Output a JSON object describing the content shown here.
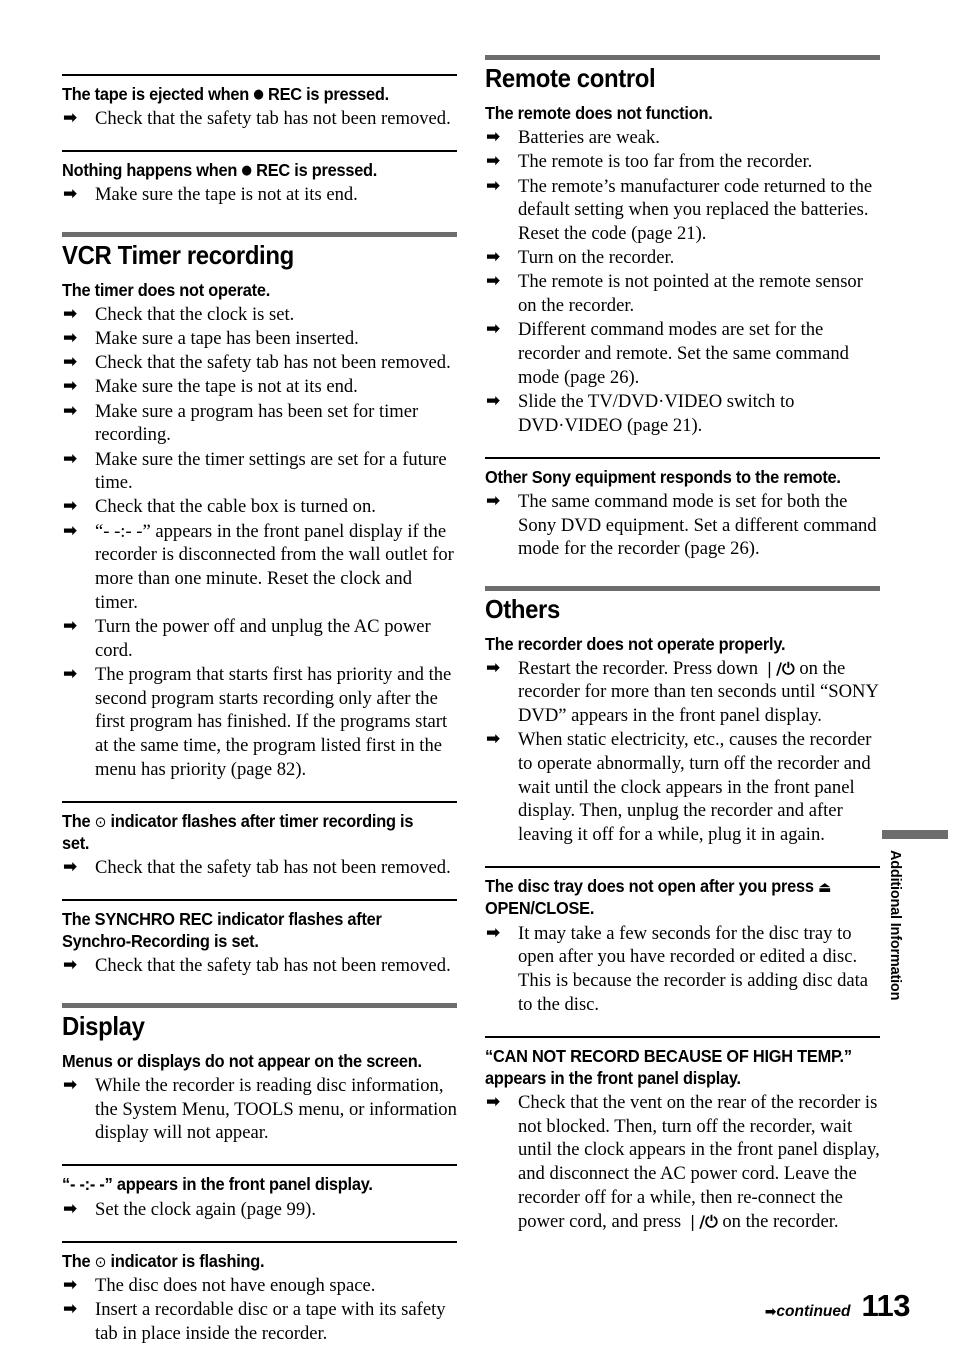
{
  "page": {
    "number": "113",
    "continued_label": "continued",
    "continued_arrow": "➡",
    "side_tab_label": "Additional Information",
    "accent_gray": "#6d6d6d"
  },
  "symbols": {
    "arrow": "➡",
    "rec_dot": "●",
    "clock": "⊙",
    "power": "⏻",
    "eject": "⏏"
  },
  "left_column": [
    {
      "type": "block",
      "rule": "thin",
      "heading_parts": [
        {
          "t": "text",
          "v": "The tape is ejected when "
        },
        {
          "t": "dot",
          "v": "●"
        },
        {
          "t": "text",
          "v": " REC is pressed."
        }
      ],
      "heading_plain": "The tape is ejected when ● REC is pressed.",
      "items": [
        "Check that the safety tab has not been removed."
      ]
    },
    {
      "type": "block",
      "rule": "thin",
      "heading_parts": [
        {
          "t": "text",
          "v": "Nothing happens when "
        },
        {
          "t": "dot",
          "v": "●"
        },
        {
          "t": "text",
          "v": " REC is pressed."
        }
      ],
      "heading_plain": "Nothing happens when ● REC is pressed.",
      "items": [
        "Make sure the tape is not at its end."
      ]
    },
    {
      "type": "section",
      "title": "VCR Timer recording"
    },
    {
      "type": "block",
      "rule": "none",
      "heading_plain": "The timer does not operate.",
      "items": [
        "Check that the clock is set.",
        "Make sure a tape has been inserted.",
        "Check that the safety tab has not been removed.",
        "Make sure the tape is not at its end.",
        "Make sure a program has been set for timer recording.",
        "Make sure the timer settings are set for a future time.",
        "Check that the cable box is turned on.",
        "“- -:- -” appears in the front panel display if the recorder is disconnected from the wall outlet for more than one minute. Reset the clock and timer.",
        "Turn the power off and unplug the AC power cord.",
        "The program that starts first has priority and the second program starts recording only after the first program has finished. If the programs start at the same time, the program listed first in the menu has priority (page 82)."
      ]
    },
    {
      "type": "block",
      "rule": "thin",
      "heading_parts": [
        {
          "t": "text",
          "v": "The "
        },
        {
          "t": "sym",
          "v": "⊙"
        },
        {
          "t": "text",
          "v": " indicator flashes after timer recording is set."
        }
      ],
      "heading_plain": "The ⊙ indicator flashes after timer recording is set.",
      "items": [
        "Check that the safety tab has not been removed."
      ]
    },
    {
      "type": "block",
      "rule": "thin",
      "heading_plain": "The SYNCHRO REC indicator flashes after Synchro-Recording is set.",
      "items": [
        "Check that the safety tab has not been removed."
      ]
    },
    {
      "type": "section",
      "title": "Display"
    },
    {
      "type": "block",
      "rule": "none",
      "heading_plain": "Menus or displays do not appear on the screen.",
      "items": [
        "While the recorder is reading disc information, the System Menu, TOOLS menu, or information display will not appear."
      ]
    },
    {
      "type": "block",
      "rule": "thin",
      "heading_plain": "“- -:- -” appears in the front panel display.",
      "items": [
        "Set the clock again (page 99)."
      ]
    },
    {
      "type": "block",
      "rule": "thin",
      "heading_parts": [
        {
          "t": "text",
          "v": "The "
        },
        {
          "t": "sym",
          "v": "⊙"
        },
        {
          "t": "text",
          "v": " indicator is flashing."
        }
      ],
      "heading_plain": "The ⊙ indicator is flashing.",
      "items": [
        "The disc does not have enough space.",
        "Insert a recordable disc or a tape with its safety tab in place inside the recorder."
      ]
    }
  ],
  "right_column": [
    {
      "type": "section",
      "title": "Remote control"
    },
    {
      "type": "block",
      "rule": "none",
      "heading_plain": "The remote does not function.",
      "items": [
        "Batteries are weak.",
        "The remote is too far from the recorder.",
        "The remote’s manufacturer code returned to the default setting when you replaced the batteries. Reset the code (page 21).",
        "Turn on the recorder.",
        "The remote is not pointed at the remote sensor on the recorder.",
        "Different command modes are set for the recorder and remote. Set the same command mode (page 26).",
        "Slide the TV/DVD·VIDEO switch to DVD·VIDEO (page 21)."
      ]
    },
    {
      "type": "block",
      "rule": "thin",
      "heading_plain": "Other Sony equipment responds to the remote.",
      "items": [
        "The same command mode is set for both the Sony DVD equipment. Set a different command mode for the recorder (page 26)."
      ]
    },
    {
      "type": "section",
      "title": "Others"
    },
    {
      "type": "block",
      "rule": "none",
      "heading_plain": "The recorder does not operate properly.",
      "items_rich": [
        [
          {
            "t": "text",
            "v": "Restart the recorder. Press down "
          },
          {
            "t": "pw",
            "v": "❘/⏻"
          },
          {
            "t": "text",
            "v": " on the recorder for more than ten seconds until “SONY DVD” appears in the front panel display."
          }
        ],
        [
          {
            "t": "text",
            "v": "When static electricity, etc., causes the recorder to operate abnormally, turn off the recorder and wait until the clock appears in the front panel display. Then, unplug the recorder and after leaving it off for a while, plug it in again."
          }
        ]
      ],
      "items": [
        "Restart the recorder. Press down ❘/⏻ on the recorder for more than ten seconds until “SONY DVD” appears in the front panel display.",
        "When static electricity, etc., causes the recorder to operate abnormally, turn off the recorder and wait until the clock appears in the front panel display. Then, unplug the recorder and after leaving it off for a while, plug it in again."
      ]
    },
    {
      "type": "block",
      "rule": "thin",
      "heading_parts": [
        {
          "t": "text",
          "v": "The disc tray does not open after you press "
        },
        {
          "t": "sym",
          "v": "⏏"
        },
        {
          "t": "text",
          "v": " OPEN/CLOSE."
        }
      ],
      "heading_plain": "The disc tray does not open after you press ⏏ OPEN/CLOSE.",
      "items": [
        "It may take a few seconds for the disc tray to open after you have recorded or edited a disc. This is because the recorder is adding disc data to the disc."
      ]
    },
    {
      "type": "block",
      "rule": "thin",
      "heading_plain": "“CAN NOT RECORD BECAUSE OF HIGH TEMP.” appears in the front panel display.",
      "items_rich": [
        [
          {
            "t": "text",
            "v": "Check that the vent on the rear of the recorder is not blocked. Then, turn off the recorder, wait until the clock appears in the front panel display, and disconnect the AC power cord. Leave the recorder off for a while, then re-connect the power cord, and press "
          },
          {
            "t": "pw",
            "v": "❘/⏻"
          },
          {
            "t": "text",
            "v": " on the recorder."
          }
        ]
      ],
      "items": [
        "Check that the vent on the rear of the recorder is not blocked. Then, turn off the recorder, wait until the clock appears in the front panel display, and disconnect the AC power cord. Leave the recorder off for a while, then re-connect the power cord, and press ❘/⏻ on the recorder."
      ]
    }
  ]
}
